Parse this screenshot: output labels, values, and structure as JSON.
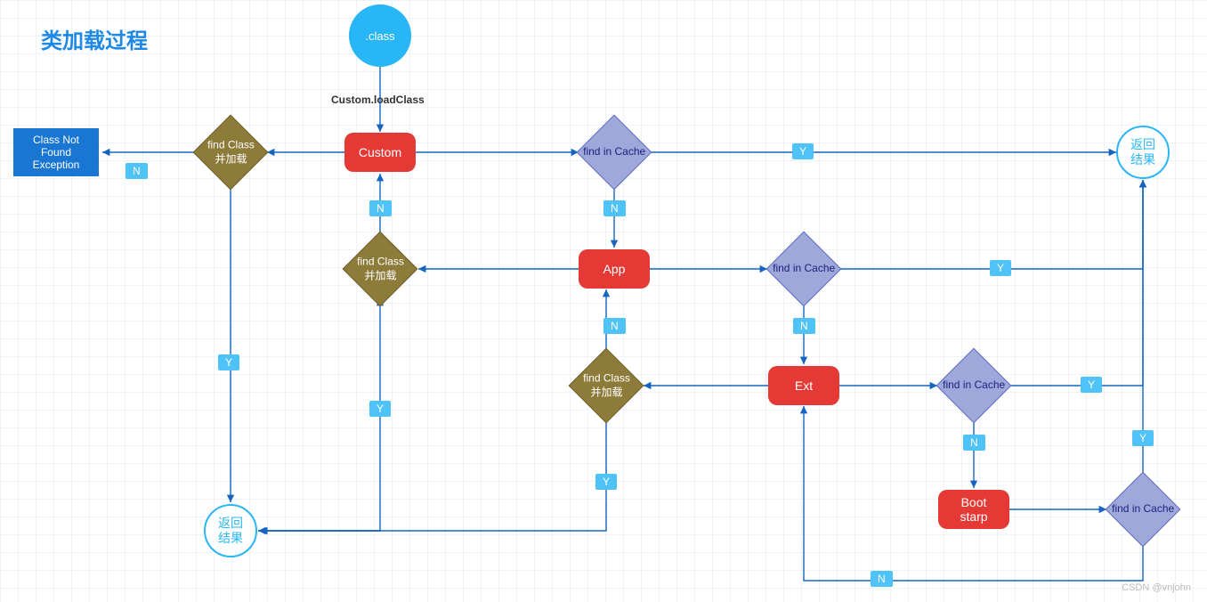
{
  "title": "类加载过程",
  "start_label": ".class",
  "edge_label_loadclass": "Custom.loadClass",
  "nodes": {
    "exception": "Class Not\nFound\nException",
    "custom": "Custom",
    "app": "App",
    "ext": "Ext",
    "bootstrap": "Boot\nstarp",
    "findclass": "find Class\n并加载",
    "findcache": "find in Cache",
    "result_cn": "返回\n结果"
  },
  "badges": {
    "Y": "Y",
    "N": "N"
  },
  "watermark": "CSDN @vnjohn",
  "colors": {
    "title": "#1e88e5",
    "red": "#e53935",
    "blue": "#1976d2",
    "purple": "#9fa8da",
    "olive": "#8d7b3a",
    "cyan": "#29b6f6",
    "line": "#1565c0"
  },
  "diagram_meta": {
    "layout_note": "Flowchart of Java classloader delegation: Custom→App→Ext→Bootstrap; each level checks cache (Y→返回结果), on miss (N) delegates up; Bootstrap on miss returns down through find Class 并加载 diamonds back to Custom; ultimate N → ClassNotFoundException."
  }
}
